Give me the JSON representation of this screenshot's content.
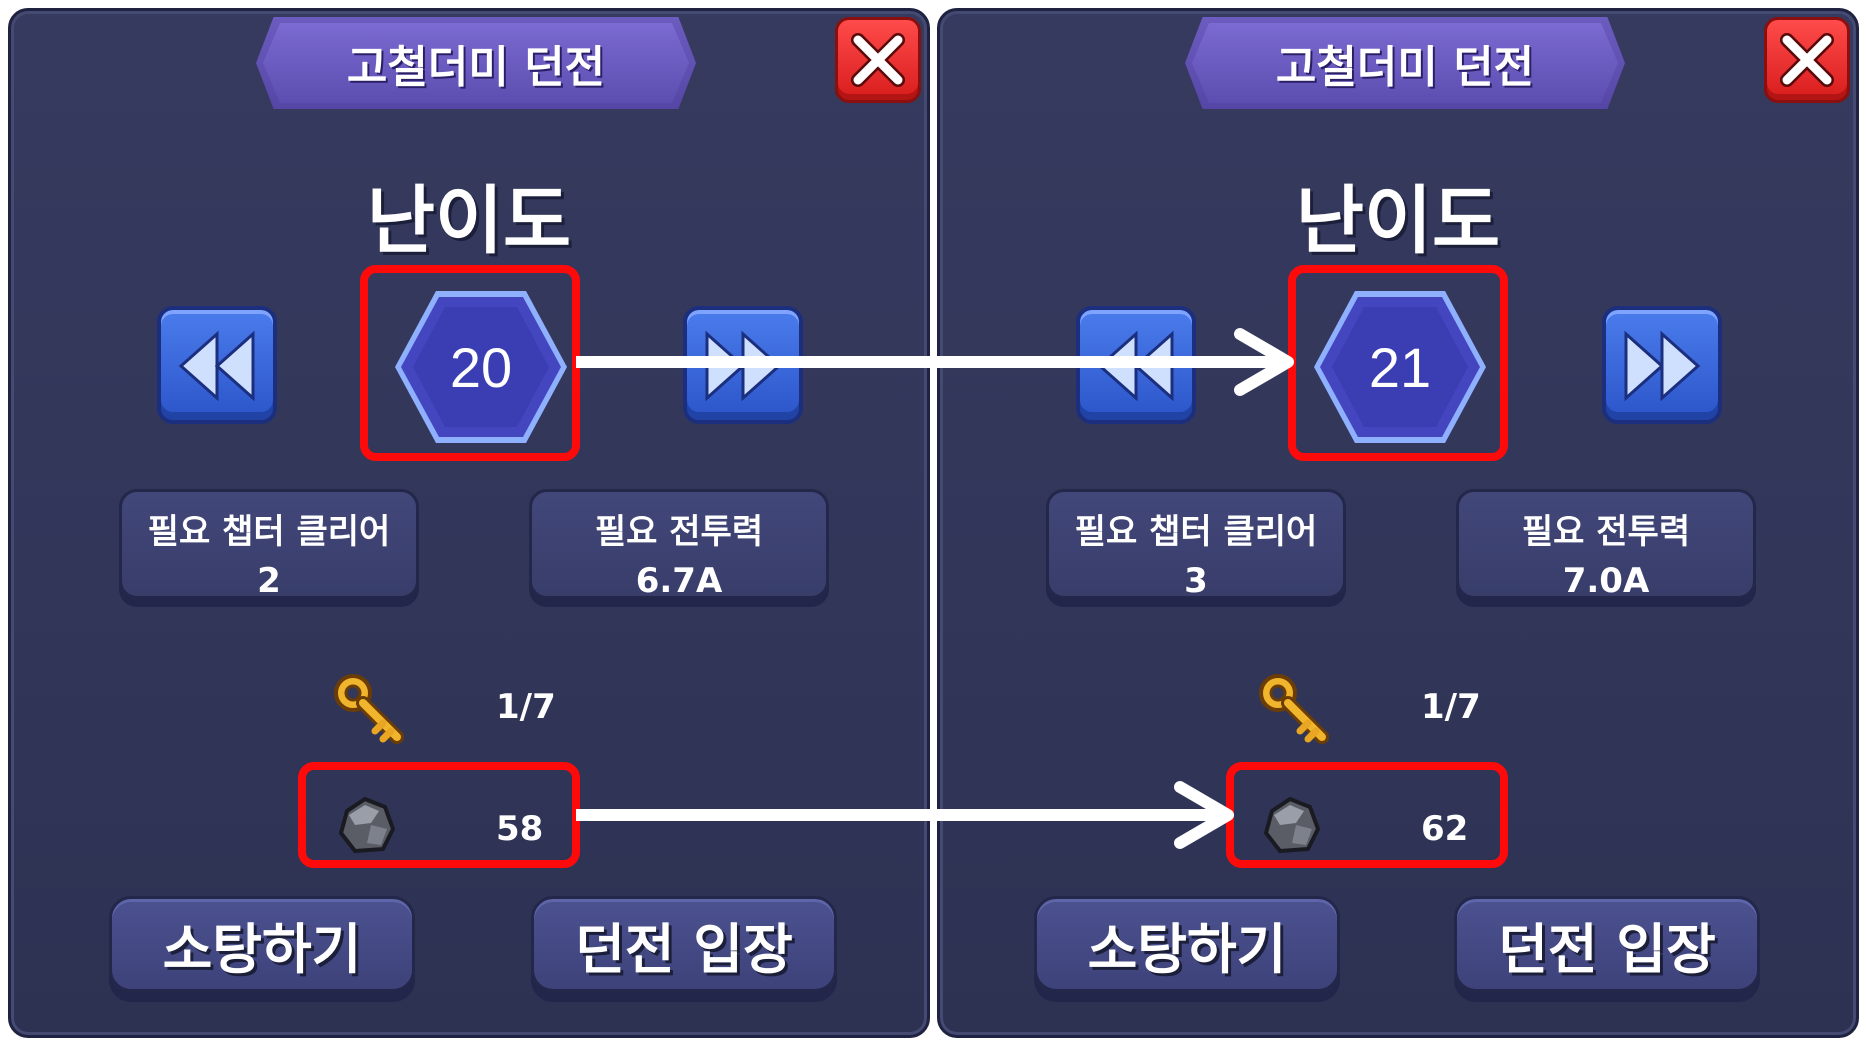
{
  "panels": [
    {
      "title": "고철더미 던전",
      "difficulty_label": "난이도",
      "level": "20",
      "req_chapter_label": "필요 챕터 클리어",
      "req_chapter_value": "2",
      "req_power_label": "필요 전투력",
      "req_power_value": "6.7A",
      "keys": "1/7",
      "ore": "58",
      "sweep_label": "소탕하기",
      "enter_label": "던전 입장"
    },
    {
      "title": "고철더미 던전",
      "difficulty_label": "난이도",
      "level": "21",
      "req_chapter_label": "필요 챕터 클리어",
      "req_chapter_value": "3",
      "req_power_label": "필요 전투력",
      "req_power_value": "7.0A",
      "keys": "1/7",
      "ore": "62",
      "sweep_label": "소탕하기",
      "enter_label": "던전 입장"
    }
  ],
  "icons": {
    "close": "close-x-icon",
    "prev": "rewind-icon",
    "next": "fast-forward-icon",
    "key": "gold-key-icon",
    "ore": "scrap-ore-icon"
  },
  "colors": {
    "panel_bg": "#343859",
    "banner": "#6a5acb",
    "hex": "#3f43b8",
    "highlight": "#ff0a0a",
    "close": "#e82626",
    "arrow_btn": "#3a66dc"
  }
}
